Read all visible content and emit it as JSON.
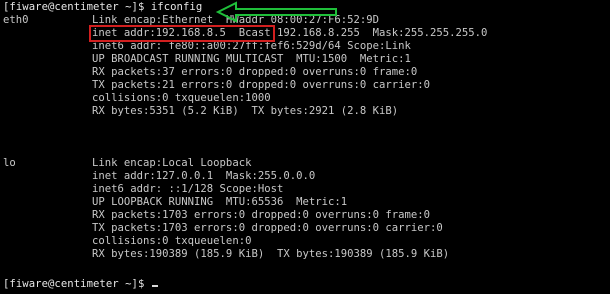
{
  "terminal": {
    "prompt_line": "[fiware@centimeter ~]$ ifconfig",
    "eth0": {
      "name": "eth0",
      "lines": [
        "Link encap:Ethernet  HWaddr 08:00:27:F6:52:9D",
        "inet addr:192.168.8.5  Bcast:192.168.8.255  Mask:255.255.255.0",
        "inet6 addr: fe80::a00:27ff:fef6:529d/64 Scope:Link",
        "UP BROADCAST RUNNING MULTICAST  MTU:1500  Metric:1",
        "RX packets:37 errors:0 dropped:0 overruns:0 frame:0",
        "TX packets:21 errors:0 dropped:0 overruns:0 carrier:0",
        "collisions:0 txqueuelen:1000",
        "RX bytes:5351 (5.2 KiB)  TX bytes:2921 (2.8 KiB)"
      ]
    },
    "lo": {
      "name": "lo",
      "lines": [
        "Link encap:Local Loopback",
        "inet addr:127.0.0.1  Mask:255.0.0.0",
        "inet6 addr: ::1/128 Scope:Host",
        "UP LOOPBACK RUNNING  MTU:65536  Metric:1",
        "RX packets:1703 errors:0 dropped:0 overruns:0 frame:0",
        "TX packets:1703 errors:0 dropped:0 overruns:0 carrier:0",
        "collisions:0 txqueuelen:0",
        "RX bytes:190389 (185.9 KiB)  TX bytes:190389 (185.9 KiB)"
      ]
    },
    "final_prompt": "[fiware@centimeter ~]$ "
  },
  "colors": {
    "background": "#000000",
    "text": "#c8c8c8",
    "highlight_border": "#d21f1f",
    "arrow": "#1fbf3a"
  }
}
